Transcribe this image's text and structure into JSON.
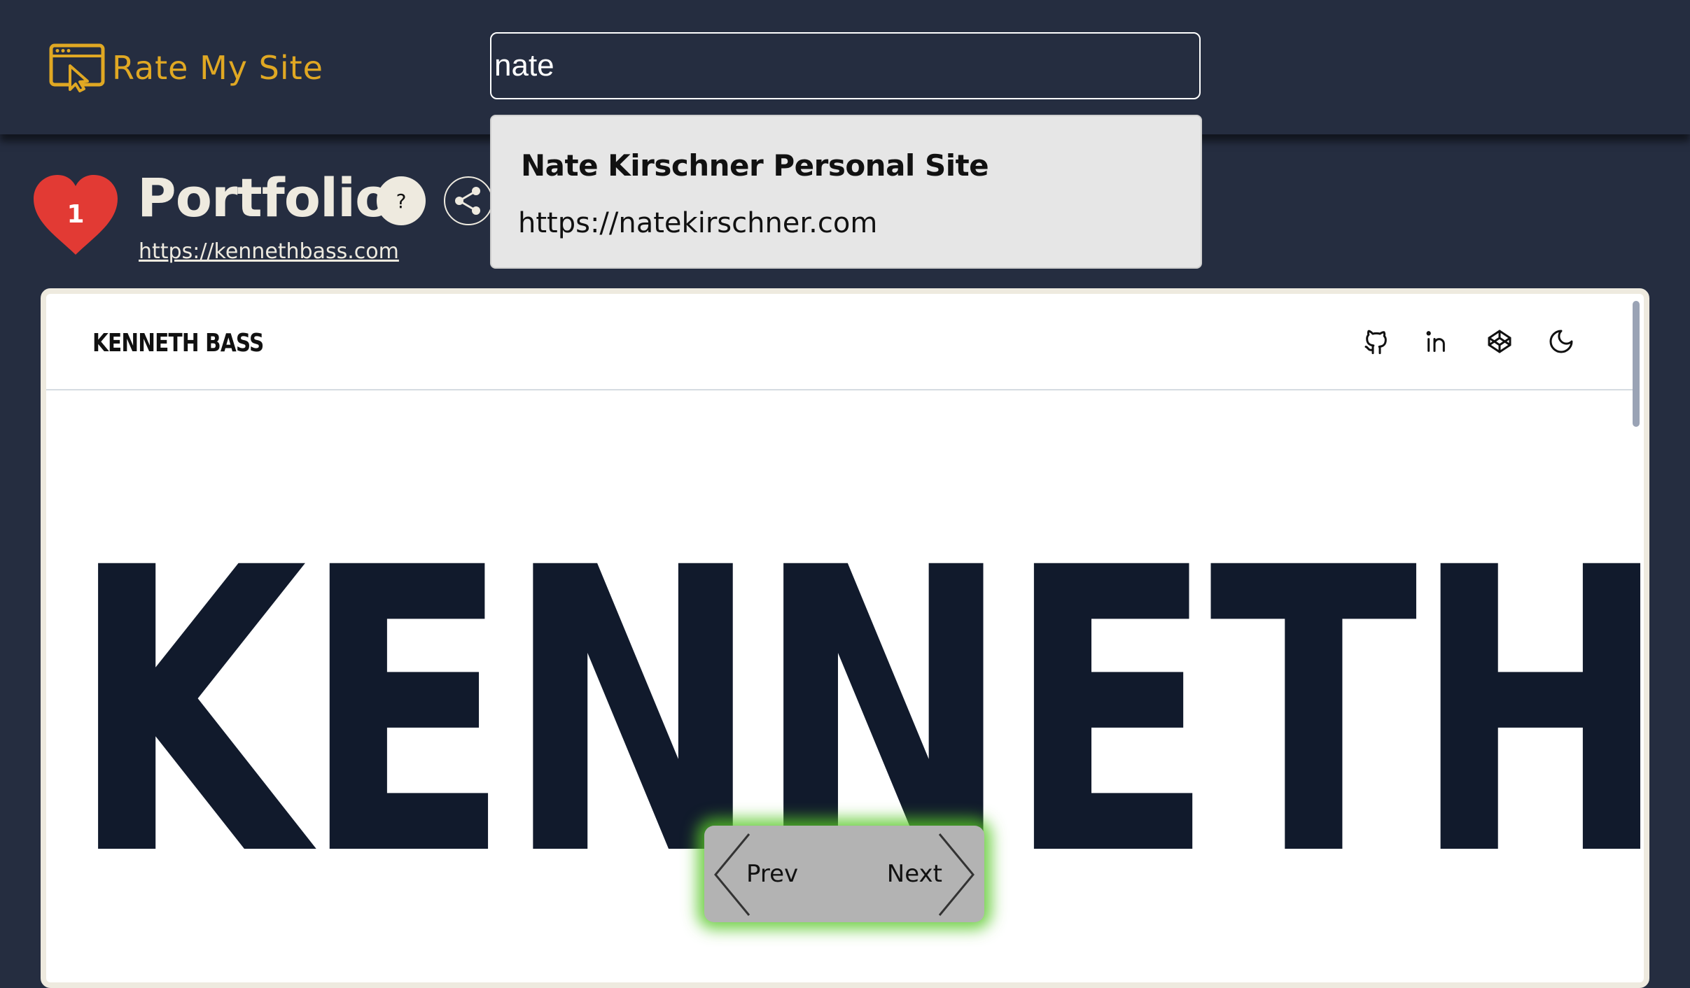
{
  "header": {
    "logo_text": "Rate My Site",
    "search_value": "nate"
  },
  "search_dropdown": {
    "result_title": "Nate Kirschner Personal Site",
    "result_url": "https://natekirschner.com"
  },
  "site": {
    "likes": "1",
    "category": "Portfolio",
    "help_label": "?",
    "url": "https://kennethbass.com"
  },
  "preview": {
    "brand": "KENNETH BASS",
    "hero_text": "KENNETH",
    "nav_icons": [
      "github-icon",
      "linkedin-icon",
      "codepen-icon",
      "moon-icon"
    ]
  },
  "pager": {
    "prev_label": "Prev",
    "next_label": "Next"
  },
  "colors": {
    "background": "#252d40",
    "logo_gold": "#e0a823",
    "heart_red": "#e23a34",
    "hero_navy": "#111a2c",
    "pager_glow": "#58c828"
  }
}
